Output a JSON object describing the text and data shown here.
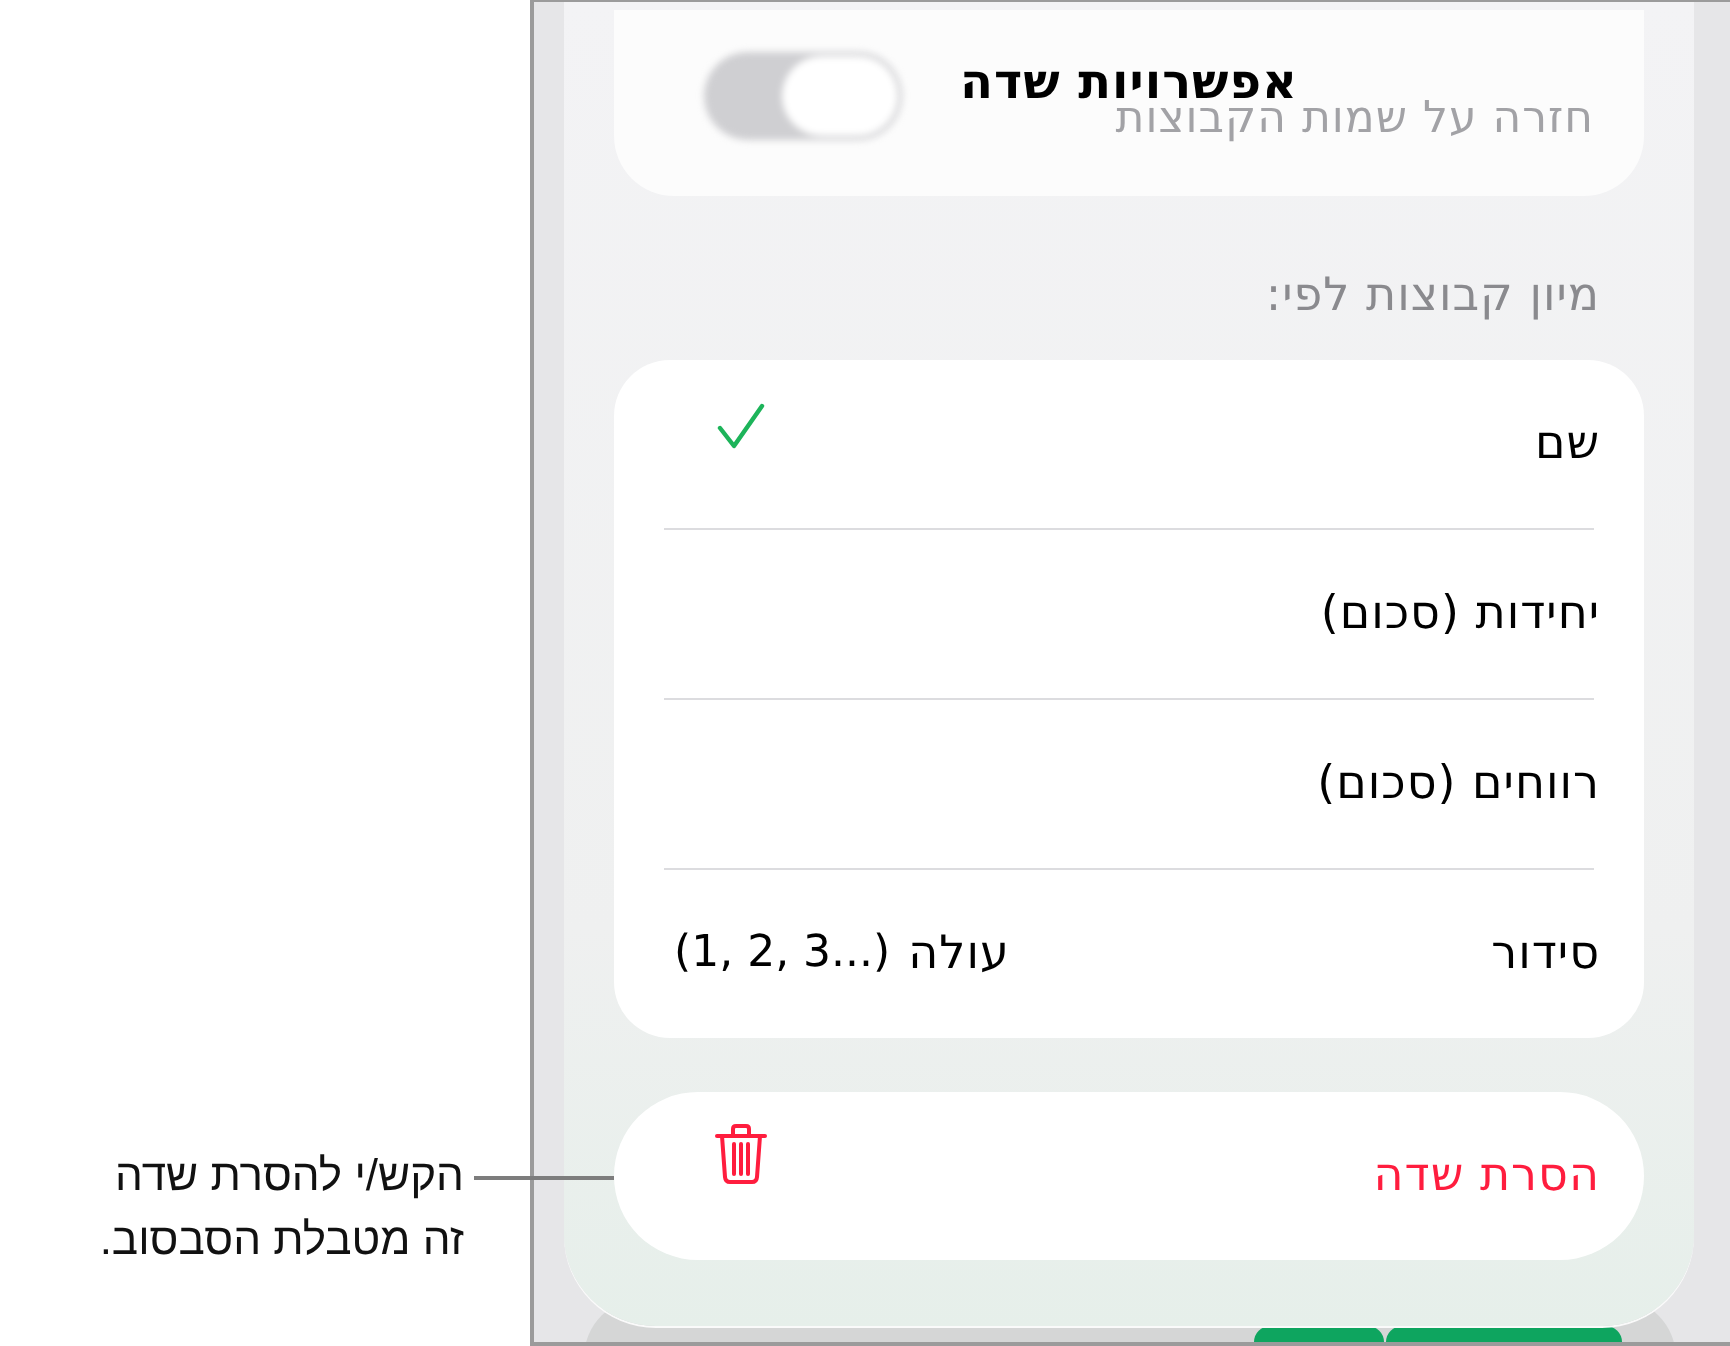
{
  "callout": {
    "lines": [
      "הקש/י להסרת שדה",
      "זה מטבלת הסבסוב."
    ]
  },
  "sheet": {
    "title": "אפשרויות שדה",
    "scrolled_row": {
      "label": "חזרה על שמות הקבוצות",
      "on": false
    },
    "section_header": "מיון קבוצות לפי:",
    "sort_options": [
      {
        "label": "שם",
        "selected": true
      },
      {
        "label": "יחידות (סכום)",
        "selected": false
      },
      {
        "label": "רווחים (סכום)",
        "selected": false
      }
    ],
    "order": {
      "label": "סידור",
      "value": "עולה",
      "range": "(1, 2, 3...)"
    },
    "delete_button": {
      "label": "הסרת שדה"
    }
  }
}
